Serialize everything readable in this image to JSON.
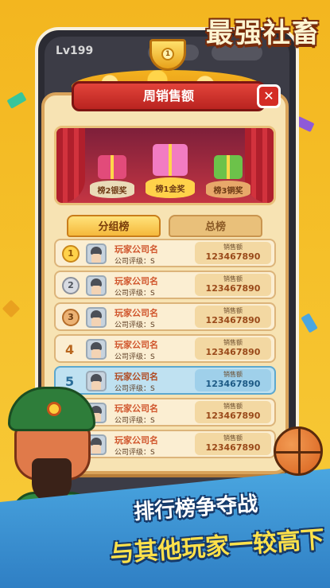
{
  "game_title": "最强社畜",
  "level": "Lv199",
  "modal": {
    "title": "周销售额",
    "close_label": "✕"
  },
  "podium": {
    "second": {
      "label": "榜2银奖"
    },
    "first": {
      "label": "榜1金奖"
    },
    "third": {
      "label": "榜3铜奖"
    }
  },
  "tabs": {
    "group": "分组榜",
    "total": "总榜"
  },
  "cup_icon_text": "1",
  "rows": [
    {
      "rank": "1",
      "name": "玩家公司名",
      "grade": "公司评级：S",
      "sales_label": "销售额",
      "sales": "123467890",
      "highlight": false
    },
    {
      "rank": "2",
      "name": "玩家公司名",
      "grade": "公司评级：S",
      "sales_label": "销售额",
      "sales": "123467890",
      "highlight": false
    },
    {
      "rank": "3",
      "name": "玩家公司名",
      "grade": "公司评级：S",
      "sales_label": "销售额",
      "sales": "123467890",
      "highlight": false
    },
    {
      "rank": "4",
      "name": "玩家公司名",
      "grade": "公司评级：S",
      "sales_label": "销售额",
      "sales": "123467890",
      "highlight": false
    },
    {
      "rank": "5",
      "name": "玩家公司名",
      "grade": "公司评级：S",
      "sales_label": "销售额",
      "sales": "123467890",
      "highlight": true
    },
    {
      "rank": "",
      "name": "玩家公司名",
      "grade": "公司评级：S",
      "sales_label": "销售额",
      "sales": "123467890",
      "highlight": false
    },
    {
      "rank": "",
      "name": "玩家公司名",
      "grade": "公司评级：S",
      "sales_label": "销售额",
      "sales": "123467890",
      "highlight": false
    }
  ],
  "slogan": {
    "line1": "排行榜争夺战",
    "line2": "与其他玩家一较高下"
  },
  "colors": {
    "background": "#f3b61f",
    "header_red": "#d42c25",
    "highlight_row": "#bfe1f1",
    "gold": "#ffd24a",
    "silver": "#c9ccd4",
    "bronze": "#d89a5a"
  }
}
